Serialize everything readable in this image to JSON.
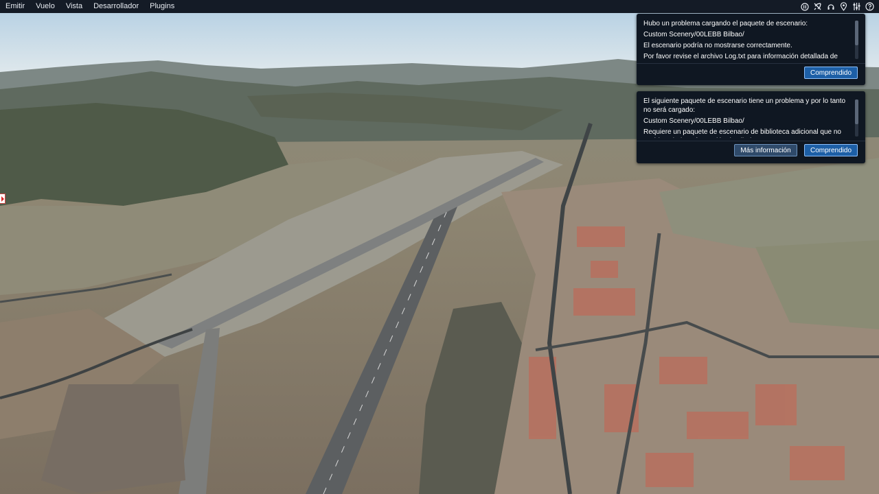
{
  "menubar": {
    "items": [
      "Emitir",
      "Vuelo",
      "Vista",
      "Desarrollador",
      "Plugins"
    ],
    "icons": [
      "pause-icon",
      "aircraft-icon",
      "atc-headset-icon",
      "map-pin-icon",
      "settings-sliders-icon",
      "help-icon"
    ]
  },
  "notifications": [
    {
      "lines": [
        "Hubo un problema cargando el paquete de escenario:",
        "Custom Scenery/00LEBB Bilbao/",
        "El escenario podría no mostrarse correctamente.",
        "Por favor revise el archivo Log.txt para información detallada de errores."
      ],
      "primary_button": "Comprendido"
    },
    {
      "lines": [
        "El siguiente paquete de escenario tiene un problema y por lo tanto no será cargado:",
        "Custom Scenery/00LEBB Bilbao/",
        "Requiere un paquete de escenario de biblioteca adicional que no está instalado. Información detallada:"
      ],
      "secondary_button": "Más información",
      "primary_button": "Comprendido"
    }
  ],
  "colors": {
    "menubar_bg": "#141b26",
    "panel_bg": "#0f1722",
    "button_primary": "#1d5fa6",
    "button_border": "#8fc3ff"
  }
}
